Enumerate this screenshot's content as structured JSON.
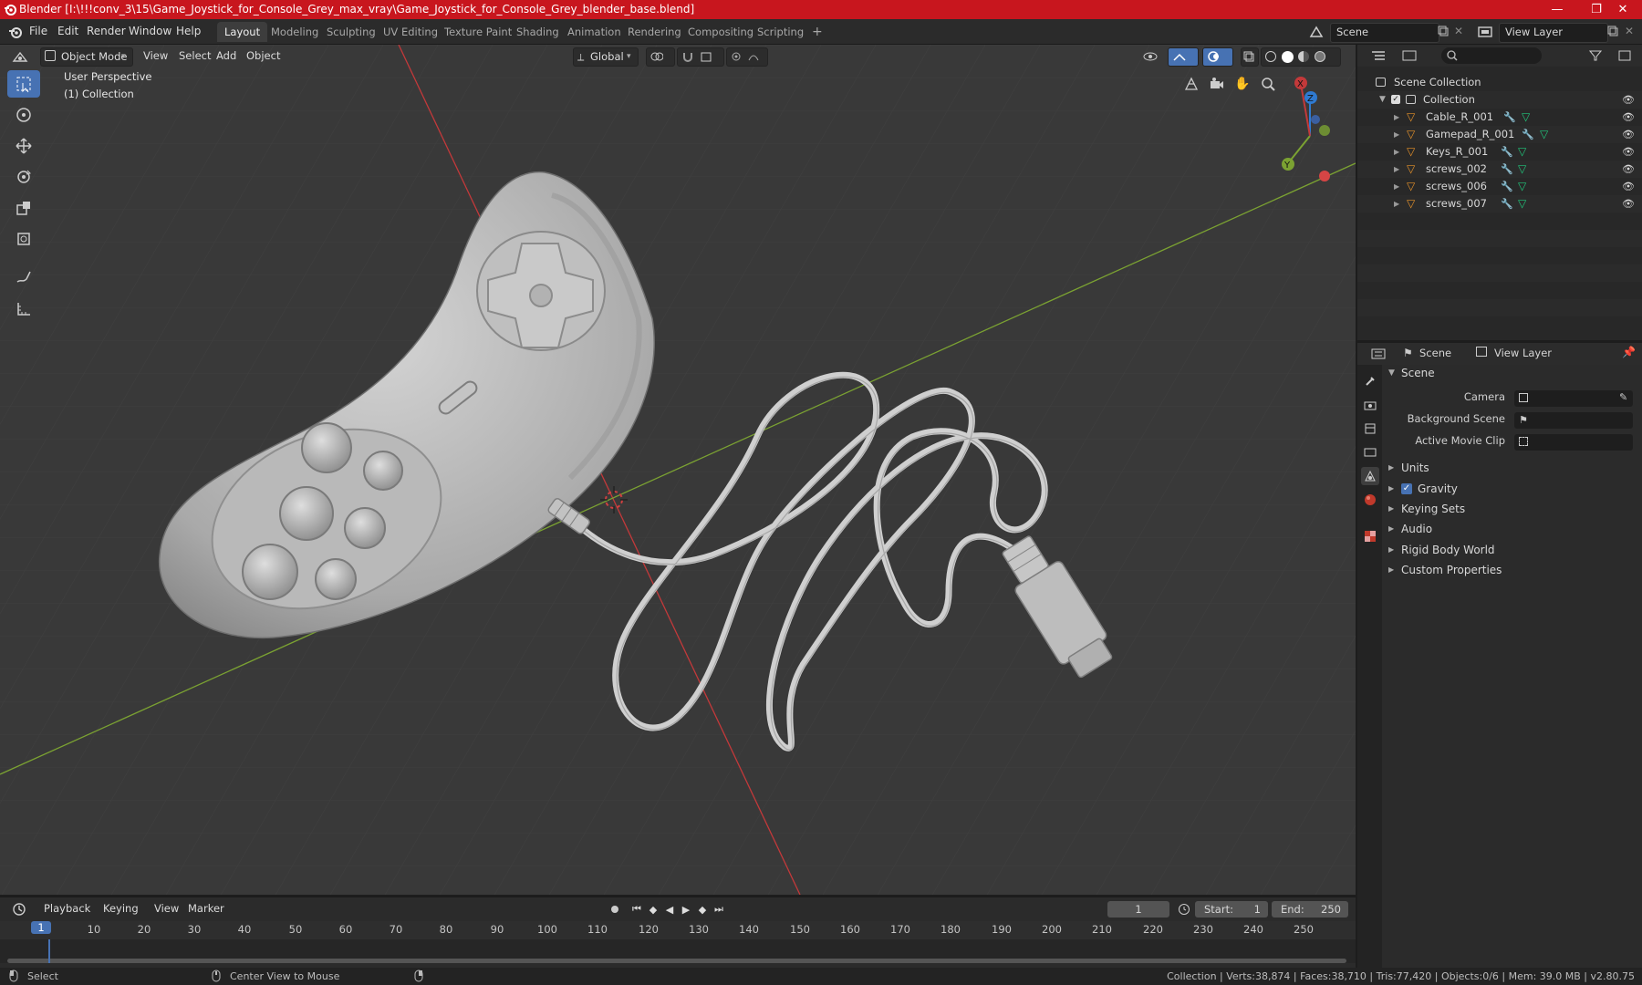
{
  "window": {
    "title": "Blender [I:\\!!!conv_3\\15\\Game_Joystick_for_Console_Grey_max_vray\\Game_Joystick_for_Console_Grey_blender_base.blend]",
    "controls": [
      "—",
      "❐",
      "✕"
    ]
  },
  "menus": [
    "File",
    "Edit",
    "Render",
    "Window",
    "Help"
  ],
  "workspaces": [
    "Layout",
    "Modeling",
    "Sculpting",
    "UV Editing",
    "Texture Paint",
    "Shading",
    "Animation",
    "Rendering",
    "Compositing",
    "Scripting"
  ],
  "workspace_add": "+",
  "scene_field": "Scene",
  "view_layer_field": "View Layer",
  "viewport": {
    "mode": "Object Mode",
    "menus": [
      "View",
      "Select",
      "Add",
      "Object"
    ],
    "transform": "Global",
    "overlay_lines": [
      "User Perspective",
      "(1) Collection"
    ],
    "gizmo_labels": {
      "x": "X",
      "y": "Y",
      "z": "Z"
    }
  },
  "outliner": {
    "root": "Scene Collection",
    "collection": "Collection",
    "objects": [
      "Cable_R_001",
      "Gamepad_R_001",
      "Keys_R_001",
      "screws_002",
      "screws_006",
      "screws_007"
    ]
  },
  "properties": {
    "tabs": [
      "Scene",
      "View Layer"
    ],
    "panel_title": "Scene",
    "fields": [
      "Camera",
      "Background Scene",
      "Active Movie Clip"
    ],
    "subpanels": [
      "Units",
      "Gravity",
      "Keying Sets",
      "Audio",
      "Rigid Body World",
      "Custom Properties"
    ],
    "gravity_checked": true
  },
  "timeline": {
    "menus": [
      "Playback",
      "Keying",
      "View",
      "Marker"
    ],
    "current_frame": "1",
    "start_label": "Start:",
    "start": "1",
    "end_label": "End:",
    "end": "250",
    "ticks": [
      "1",
      "10",
      "20",
      "30",
      "40",
      "50",
      "60",
      "70",
      "80",
      "90",
      "100",
      "110",
      "120",
      "130",
      "140",
      "150",
      "160",
      "170",
      "180",
      "190",
      "200",
      "210",
      "220",
      "230",
      "240",
      "250"
    ]
  },
  "status": {
    "left": "Select",
    "middle": "Center View to Mouse",
    "right": "Collection | Verts:38,874 | Faces:38,710 | Tris:77,420 | Objects:0/6 | Mem: 39.0 MB | v2.80.75"
  },
  "colors": {
    "accent": "#4772b3",
    "title_bar": "#c8161e",
    "x_axis": "#c3393a",
    "y_axis": "#7ba232",
    "z_axis": "#2f7ad1"
  }
}
